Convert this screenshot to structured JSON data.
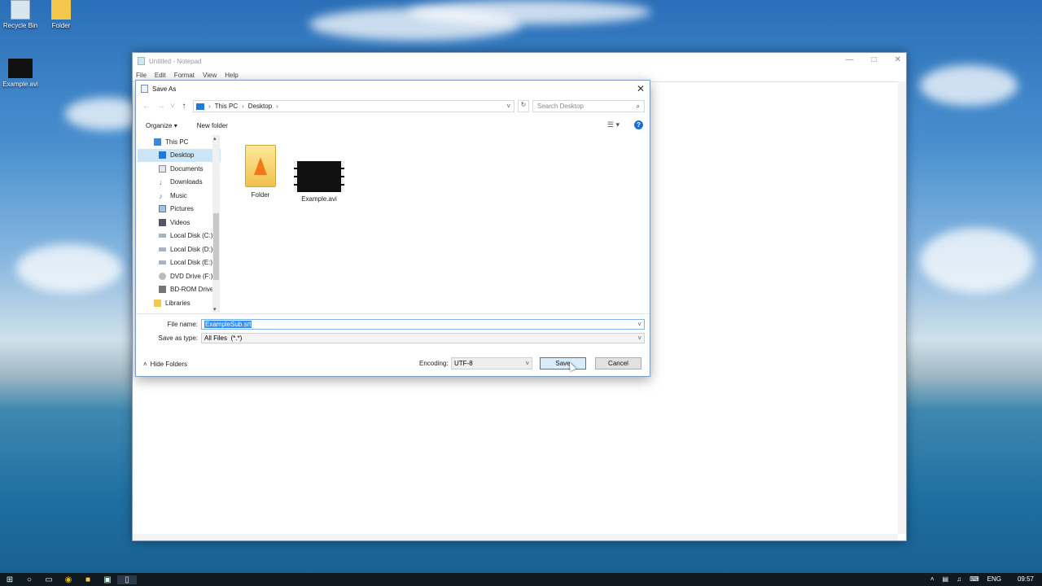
{
  "desktop": {
    "icons": [
      {
        "label": "Recycle Bin"
      },
      {
        "label": "Folder"
      },
      {
        "label": "Example.avi"
      }
    ]
  },
  "notepad": {
    "title": "Untitled - Notepad",
    "menu": [
      "File",
      "Edit",
      "Format",
      "View",
      "Help"
    ]
  },
  "dialog": {
    "title": "Save As",
    "address": {
      "root": "This PC",
      "folder": "Desktop"
    },
    "search_placeholder": "Search Desktop",
    "toolbar": {
      "organize": "Organize",
      "new_folder": "New folder"
    },
    "nav_items": [
      {
        "label": "This PC",
        "icon": "computer-icon"
      },
      {
        "label": "Desktop",
        "icon": "desktop-icon",
        "selected": true
      },
      {
        "label": "Documents",
        "icon": "document-icon"
      },
      {
        "label": "Downloads",
        "icon": "download-icon"
      },
      {
        "label": "Music",
        "icon": "music-icon"
      },
      {
        "label": "Pictures",
        "icon": "picture-icon"
      },
      {
        "label": "Videos",
        "icon": "video-icon"
      },
      {
        "label": "Local Disk (C:)",
        "icon": "disk-icon"
      },
      {
        "label": "Local Disk (D:)",
        "icon": "disk-icon"
      },
      {
        "label": "Local Disk (E:)",
        "icon": "disk-icon"
      },
      {
        "label": "DVD Drive (F:)",
        "icon": "dvd-icon"
      },
      {
        "label": "BD-ROM Drive",
        "icon": "bd-icon"
      },
      {
        "label": "Libraries",
        "icon": "library-icon"
      }
    ],
    "files": [
      {
        "name": "Folder",
        "icon": "folder-icon"
      },
      {
        "name": "Example.avi",
        "icon": "video-file-icon"
      }
    ],
    "file_name_label": "File name:",
    "file_name_value": "ExampleSub.srt",
    "save_type_label": "Save as type:",
    "save_type_value": "All Files  (*.*)",
    "hide_folders": "Hide Folders",
    "encoding_label": "Encoding:",
    "encoding_value": "UTF-8",
    "save_button": "Save",
    "cancel_button": "Cancel"
  },
  "taskbar": {
    "language": "ENG",
    "time": "09:57"
  }
}
